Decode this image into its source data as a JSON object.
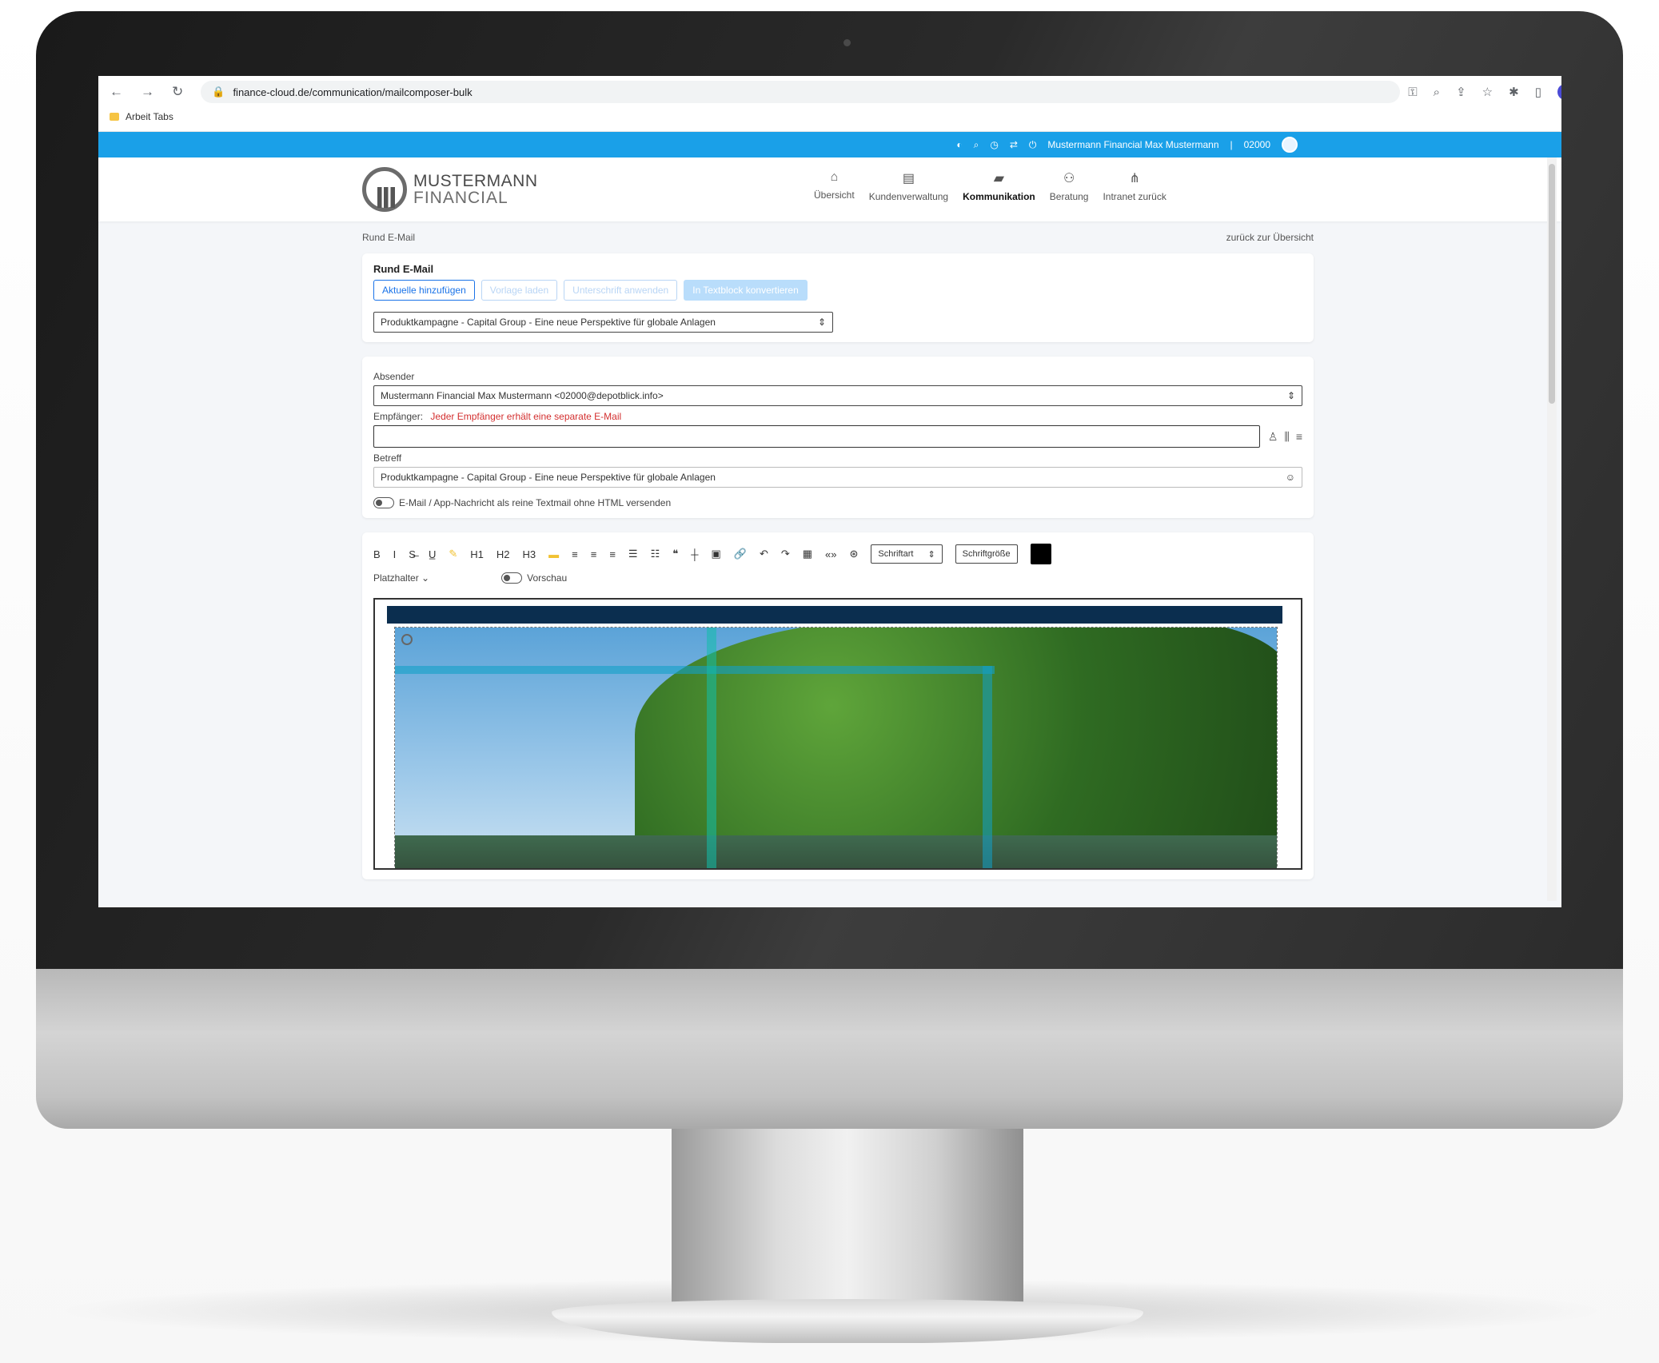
{
  "browser": {
    "url": "finance-cloud.de/communication/mailcomposer-bulk",
    "bookmark": "Arbeit Tabs"
  },
  "topbar": {
    "user": "Mustermann Financial Max Mustermann",
    "id": "02000"
  },
  "header": {
    "logo_line1": "MUSTERMANN",
    "logo_line2": "FINANCIAL",
    "nav": [
      {
        "label": "Übersicht",
        "icon": "home-icon",
        "active": false
      },
      {
        "label": "Kundenverwaltung",
        "icon": "list-icon",
        "active": false
      },
      {
        "label": "Kommunikation",
        "icon": "chat-icon",
        "active": true
      },
      {
        "label": "Beratung",
        "icon": "people-icon",
        "active": false
      },
      {
        "label": "Intranet zurück",
        "icon": "network-icon",
        "active": false
      }
    ]
  },
  "breadcrumb": {
    "left": "Rund E-Mail",
    "right": "zurück zur Übersicht"
  },
  "campaign": {
    "title": "Rund E-Mail",
    "buttons": [
      "Aktuelle hinzufügen",
      "Vorlage laden",
      "Unterschrift anwenden",
      "In Textblock konvertieren"
    ],
    "select_value": "Produktkampagne - Capital Group - Eine neue Perspektive für globale Anlagen"
  },
  "mail": {
    "sender_label": "Absender",
    "sender_value": "Mustermann Financial Max Mustermann <02000@depotblick.info>",
    "recipients_label": "Empfänger",
    "recipients_hint": "Jeder Empfänger erhält eine separate E-Mail",
    "subject_label": "Betreff",
    "subject_value": "Produktkampagne - Capital Group - Eine neue Perspektive für globale Anlagen",
    "toggle_label": "E-Mail / App-Nachricht als reine Textmail ohne HTML versenden"
  },
  "editor": {
    "font_select": "Schriftart",
    "size_select": "Schriftgröße",
    "placeholder_label": "Platzhalter",
    "preview_label": "Vorschau",
    "swatch_color": "#000000"
  }
}
